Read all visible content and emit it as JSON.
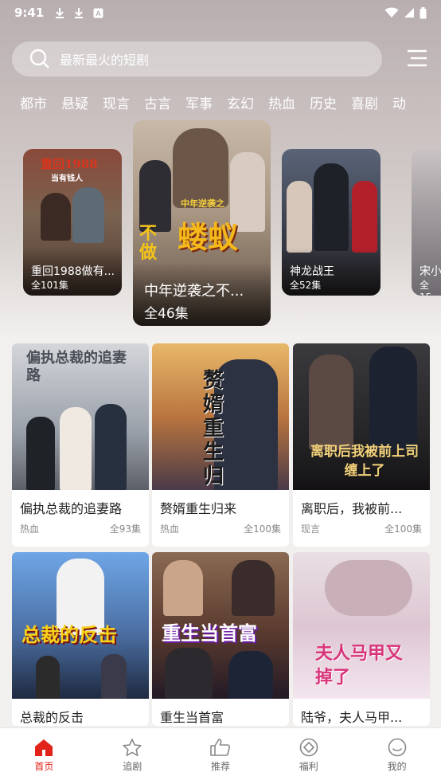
{
  "status": {
    "time": "9:41"
  },
  "search": {
    "placeholder": "最新最火的短剧"
  },
  "categories": [
    "都市",
    "悬疑",
    "现言",
    "古言",
    "军事",
    "玄幻",
    "热血",
    "历史",
    "喜剧",
    "动"
  ],
  "carousel": [
    {
      "title": "重回1988做有...",
      "episodes": "全101集",
      "poster_text": "重回1988",
      "poster_sub": "当有钱人"
    },
    {
      "title": "中年逆袭之不...",
      "episodes": "全46集",
      "poster_text": "蝼蚁",
      "poster_sub": "不做",
      "poster_tag": "中年逆袭之"
    },
    {
      "title": "神龙战王",
      "episodes": "全52集"
    },
    {
      "title": "宋小",
      "episodes": "全15"
    }
  ],
  "grid": [
    {
      "title": "偏执总裁的追妻路",
      "genre": "热血",
      "episodes": "全93集",
      "poster_text": "偏执总裁的追妻路"
    },
    {
      "title": "赘婿重生归来",
      "genre": "热血",
      "episodes": "全100集",
      "poster_text": "赘婿重生归"
    },
    {
      "title": "离职后，我被前...",
      "genre": "现言",
      "episodes": "全100集",
      "poster_text": "离职后我被前上司缠上了"
    },
    {
      "title": "总裁的反击",
      "genre": "",
      "episodes": "",
      "poster_text": "总裁的反击"
    },
    {
      "title": "重生当首富",
      "genre": "",
      "episodes": "",
      "poster_text": "重生当首富"
    },
    {
      "title": "陆爷，夫人马甲...",
      "genre": "",
      "episodes": "",
      "poster_text": "夫人马甲又掉了"
    }
  ],
  "tabs": [
    {
      "label": "首页",
      "icon": "home-icon",
      "active": true
    },
    {
      "label": "追剧",
      "icon": "star-icon"
    },
    {
      "label": "推荐",
      "icon": "thumbs-up-icon"
    },
    {
      "label": "福利",
      "icon": "gift-icon"
    },
    {
      "label": "我的",
      "icon": "profile-icon"
    }
  ],
  "colors": {
    "accent": "#e2231a"
  }
}
